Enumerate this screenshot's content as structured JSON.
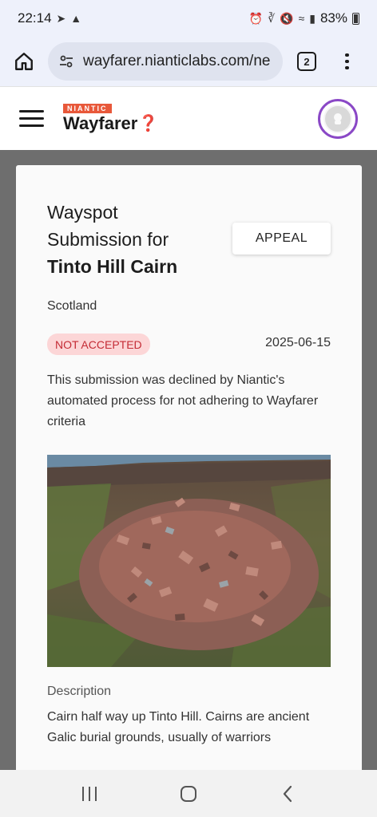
{
  "status_bar": {
    "time": "22:14",
    "battery": "83%"
  },
  "browser": {
    "url": "wayfarer.nianticlabs.com/ne",
    "tab_count": "2"
  },
  "header": {
    "brand_top": "NIANTIC",
    "brand_name": "Wayfarer"
  },
  "submission": {
    "title_line1": "Wayspot",
    "title_line2": "Submission for",
    "title_name": "Tinto Hill Cairn",
    "appeal_label": "APPEAL",
    "location": "Scotland",
    "status": "NOT ACCEPTED",
    "date": "2025-06-15",
    "decline_message": "This submission was declined by Niantic's automated process for not adhering to Wayfarer criteria",
    "description_label": "Description",
    "description": "Cairn half way up Tinto Hill. Cairns are ancient Galic burial grounds, usually of warriors"
  },
  "colors": {
    "accent_purple": "#8a48c6",
    "niantic_orange": "#e8583a",
    "status_bg": "#fcd6d7",
    "status_text": "#c42b35"
  }
}
